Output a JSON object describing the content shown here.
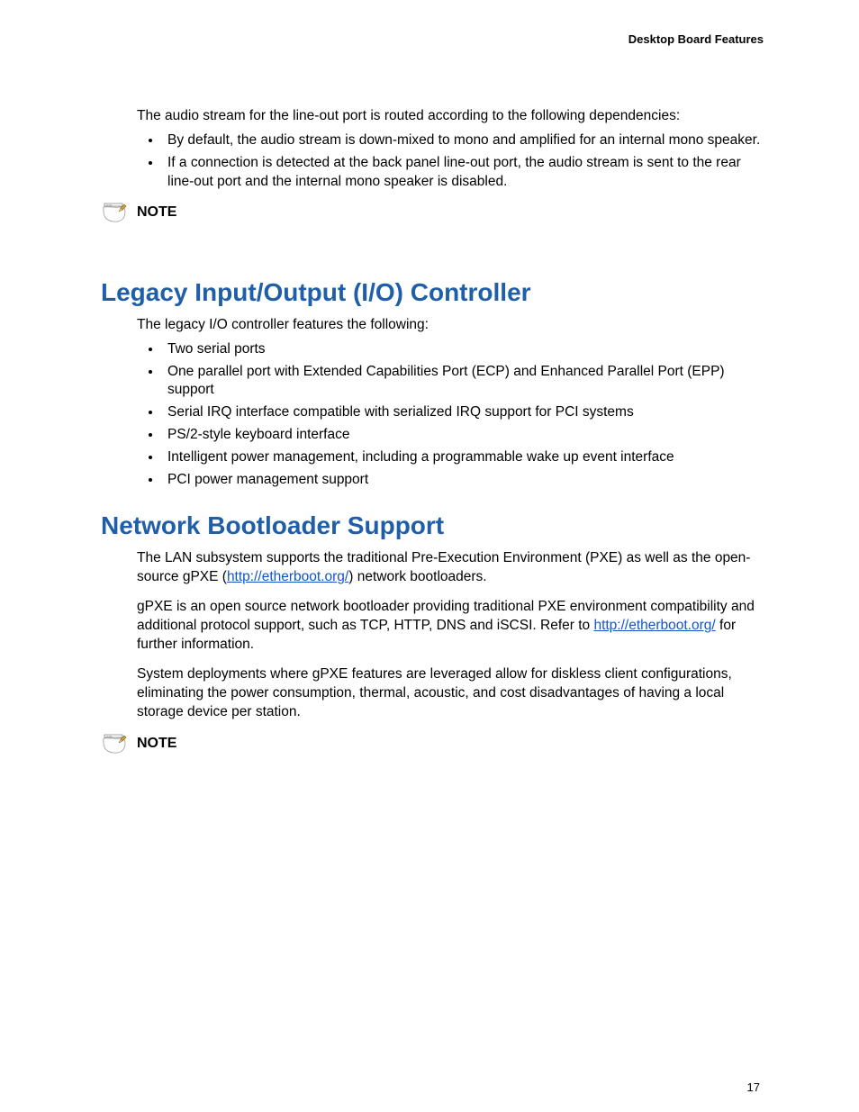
{
  "header": "Desktop Board Features",
  "intro_paragraph": "The audio stream for the line-out port is routed according to the following dependencies:",
  "intro_bullets": [
    "By default, the audio stream is down-mixed to mono and amplified for an internal mono speaker.",
    "If a connection is detected at the back panel line-out port, the audio stream is sent to the rear line-out port and the internal mono speaker is disabled."
  ],
  "note_label": "NOTE",
  "section1": {
    "title": "Legacy Input/Output (I/O) Controller",
    "intro": "The legacy I/O controller features the following:",
    "bullets": [
      "Two serial ports",
      "One parallel port with Extended Capabilities Port (ECP) and Enhanced Parallel Port (EPP) support",
      "Serial IRQ interface compatible with serialized IRQ support for PCI systems",
      "PS/2-style keyboard interface",
      "Intelligent power management, including a programmable wake up event interface",
      "PCI power management support"
    ]
  },
  "section2": {
    "title": "Network Bootloader Support",
    "p1_pre": "The LAN subsystem supports the traditional Pre-Execution Environment (PXE) as well as the open-source gPXE (",
    "p1_link": "http://etherboot.org/",
    "p1_post": ") network bootloaders.",
    "p2_pre": "gPXE is an open source network bootloader providing traditional PXE environment compatibility and additional protocol support, such as TCP, HTTP, DNS and iSCSI. Refer to ",
    "p2_link": "http://etherboot.org/",
    "p2_post": " for further information.",
    "p3": "System deployments where gPXE features are leveraged allow for diskless client configurations, eliminating the power consumption, thermal, acoustic, and cost disadvantages of having a local storage device per station."
  },
  "page_number": "17"
}
